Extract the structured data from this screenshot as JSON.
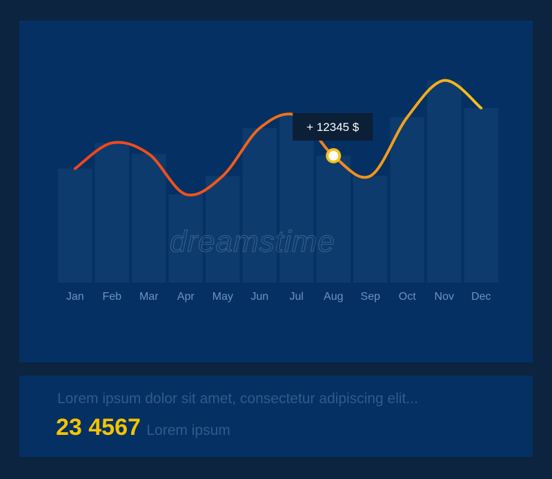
{
  "chart_data": {
    "type": "line",
    "categories": [
      "Jan",
      "Feb",
      "Mar",
      "Apr",
      "May",
      "Jun",
      "Jul",
      "Aug",
      "Sep",
      "Oct",
      "Nov",
      "Dec"
    ],
    "series": [
      {
        "values": [
          62,
          76,
          70,
          48,
          58,
          84,
          91,
          69,
          58,
          90,
          110,
          95
        ]
      }
    ],
    "bars": [
      62,
      76,
      70,
      48,
      58,
      84,
      91,
      69,
      58,
      90,
      110,
      95
    ],
    "ylim": [
      0,
      120
    ],
    "grid": false,
    "legend": "none",
    "highlight": {
      "category": "Aug",
      "label": "+ 12345 $"
    },
    "colors": {
      "background": "#053063",
      "bar": "#0d3b6e",
      "line_start": "#f0441c",
      "line_end": "#f5c21a",
      "tick": "#6b94c3",
      "tooltip_bg": "#0b1f36",
      "tooltip_text": "#ffffff"
    }
  },
  "watermark": "dreamstime",
  "info": {
    "caption": "Lorem ipsum dolor sit amet, consectetur adipiscing elit...",
    "value": "23 4567",
    "value_label": "Lorem ipsum"
  }
}
